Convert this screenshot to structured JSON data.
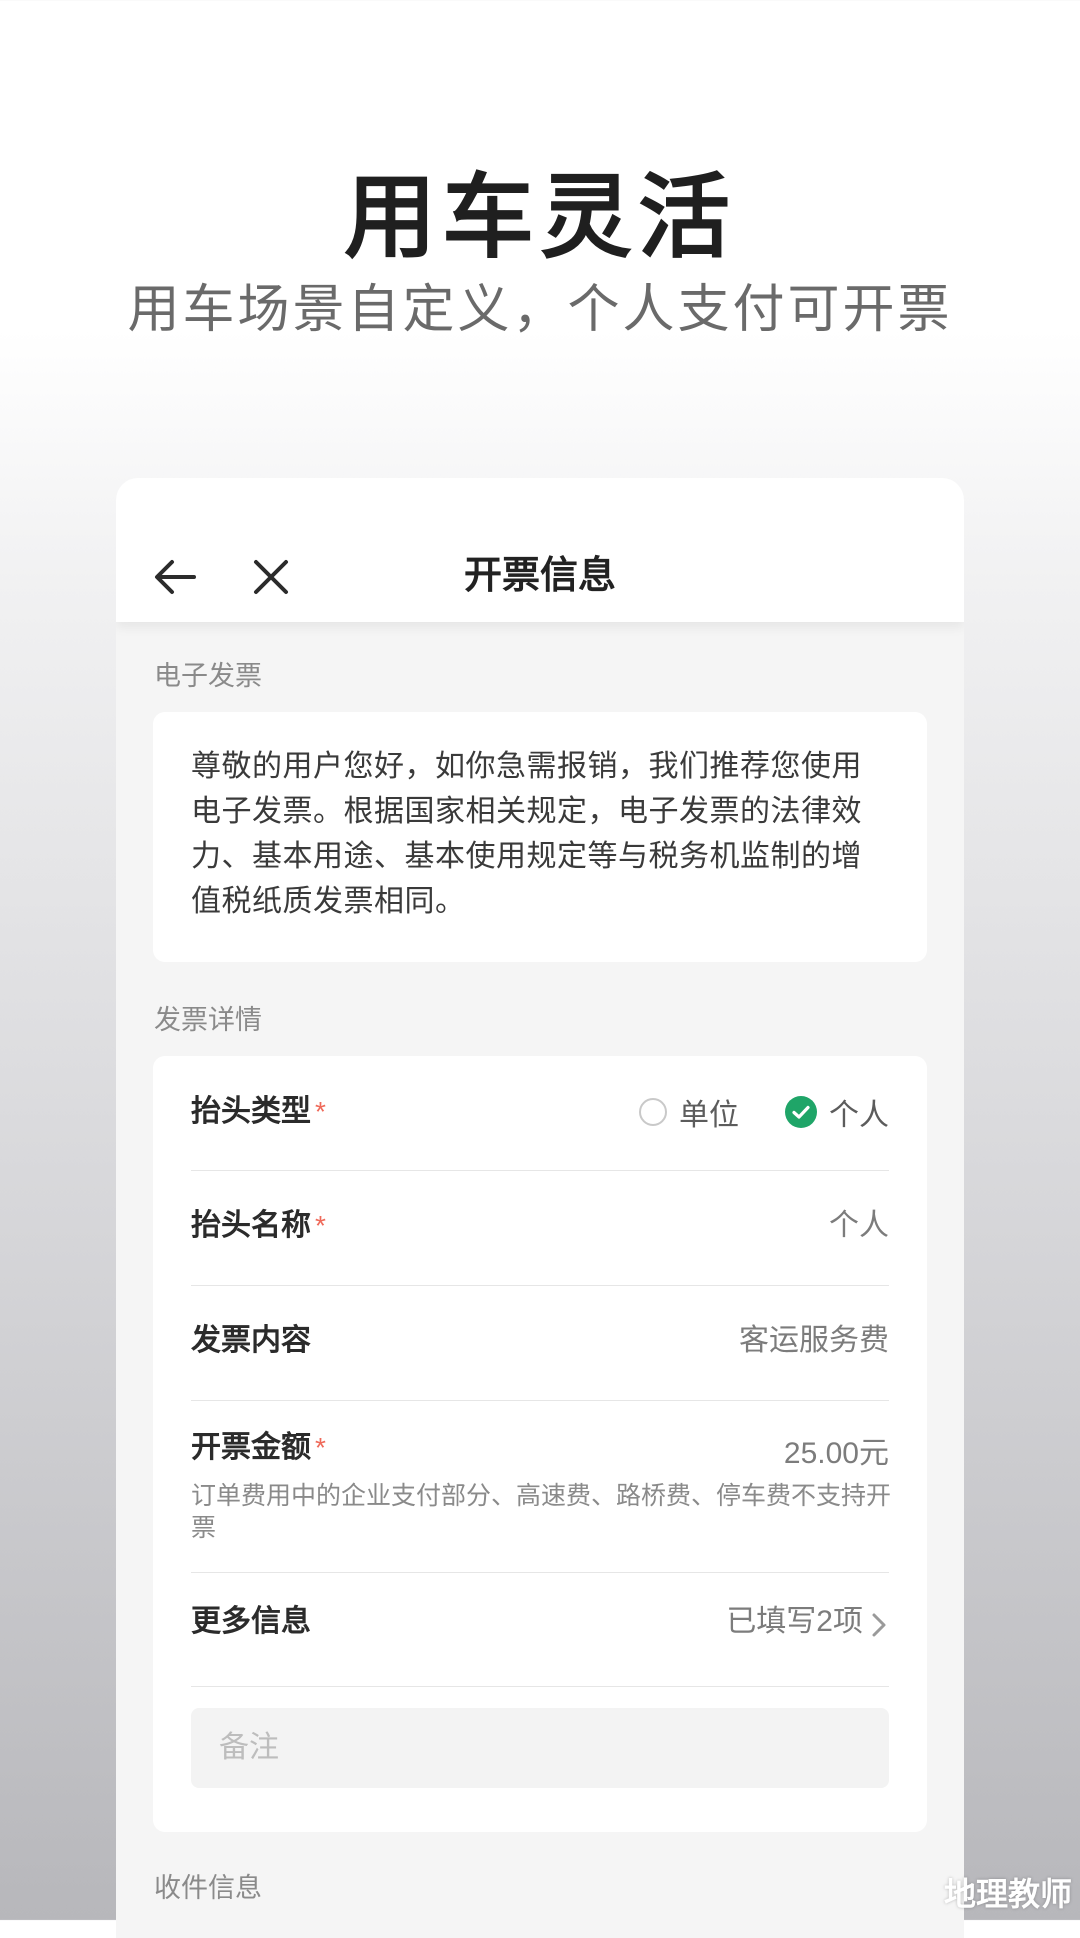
{
  "promo": {
    "title": "用车灵活",
    "subtitle": "用车场景自定义，个人支付可开票"
  },
  "navbar": {
    "title": "开票信息",
    "back_icon": "arrow-left-icon",
    "close_icon": "close-icon"
  },
  "electronic_invoice": {
    "section_label": "电子发票",
    "notice": "尊敬的用户您好，如你急需报销，我们推荐您使用电子发票。根据国家相关规定，电子发票的法律效力、基本用途、基本使用规定等与税务机监制的增值税纸质发票相同。"
  },
  "invoice_details": {
    "section_label": "发票详情",
    "header_type": {
      "label": "抬头类型",
      "required_mark": "*",
      "options": [
        {
          "label": "单位",
          "selected": false
        },
        {
          "label": "个人",
          "selected": true
        }
      ]
    },
    "header_name": {
      "label": "抬头名称",
      "required_mark": "*",
      "value": "个人"
    },
    "content": {
      "label": "发票内容",
      "value": "客运服务费"
    },
    "amount": {
      "label": "开票金额",
      "required_mark": "*",
      "value": "25.00元",
      "note": "订单费用中的企业支付部分、高速费、路桥费、停车费不支持开票"
    },
    "more_info": {
      "label": "更多信息",
      "value": "已填写2项",
      "chevron_icon": "chevron-right-icon"
    },
    "remark": {
      "placeholder": "备注",
      "value": ""
    }
  },
  "shipping": {
    "section_label": "收件信息"
  },
  "watermark": {
    "text": "地理教师"
  },
  "colors": {
    "accent_green": "#1fa568",
    "required_red": "#ef6a5a"
  }
}
